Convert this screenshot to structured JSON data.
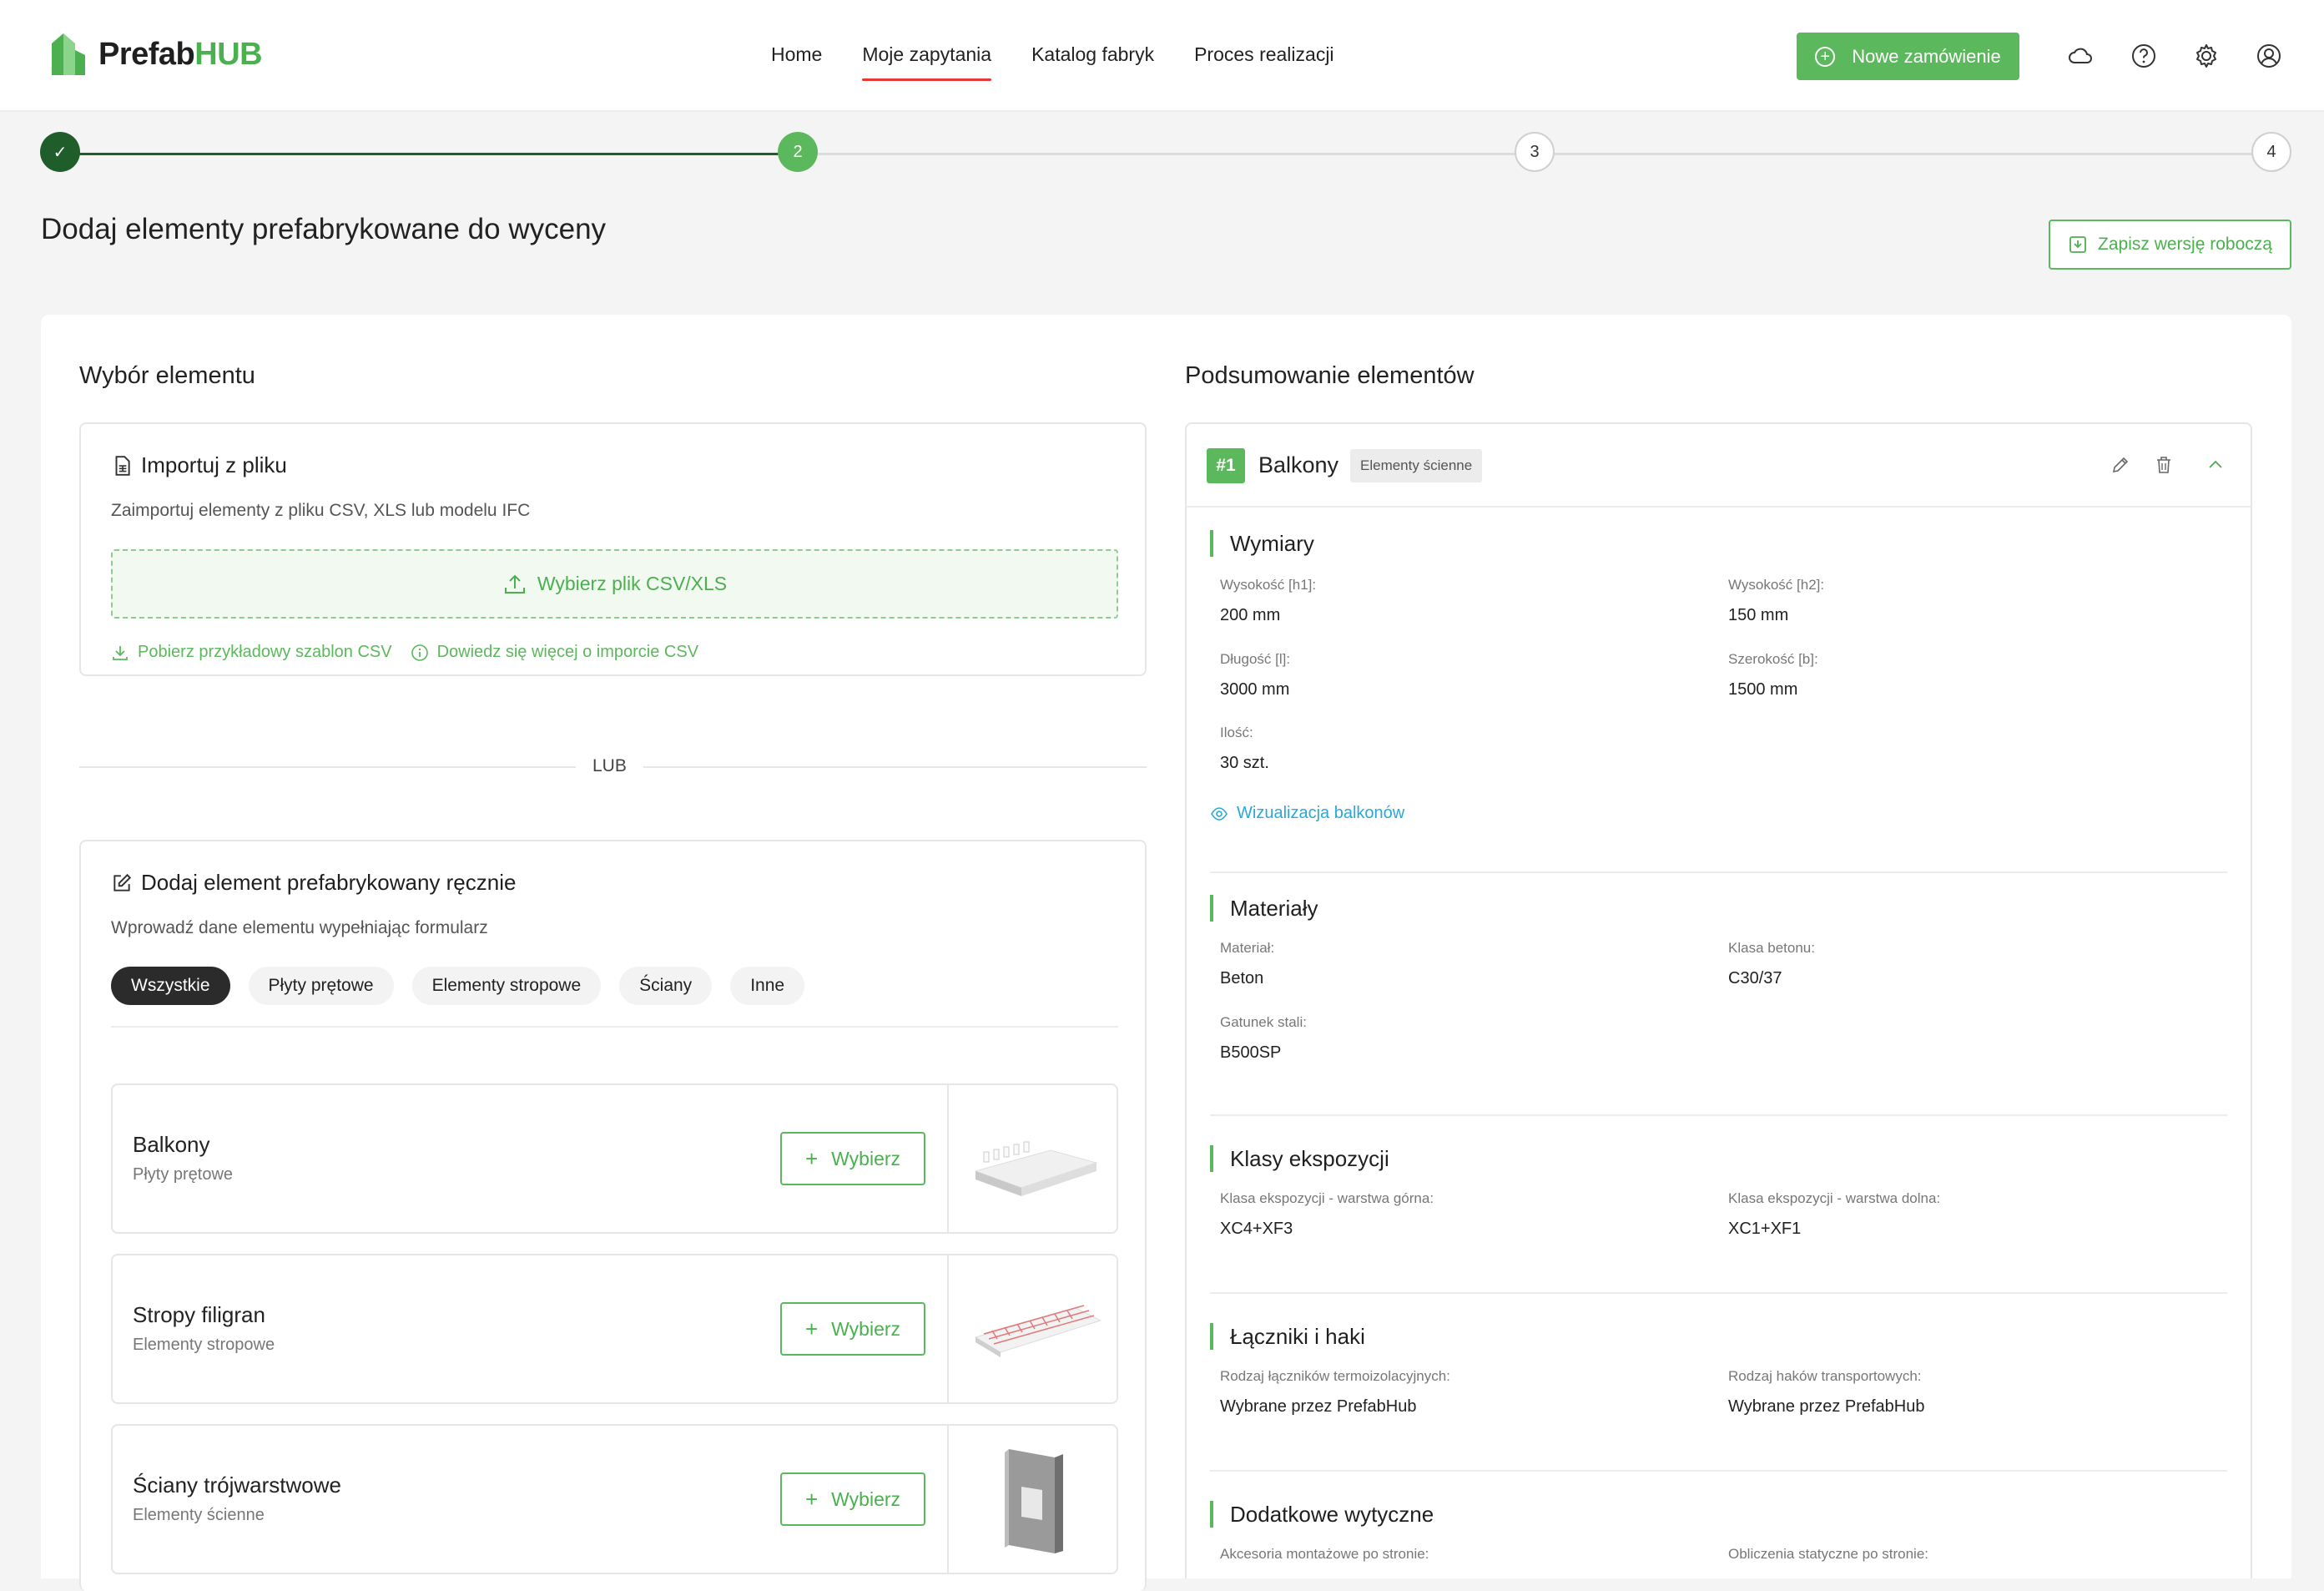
{
  "header": {
    "logo_text_1": "Prefab",
    "logo_text_2": "HUB",
    "nav": [
      "Home",
      "Moje zapytania",
      "Katalog fabryk",
      "Proces realizacji"
    ],
    "active_nav": "Moje zapytania",
    "new_order_label": "Nowe zamówienie",
    "icons": [
      "cloud-icon",
      "help-icon",
      "settings-icon",
      "user-icon"
    ]
  },
  "stepper": {
    "steps": [
      "✓",
      "2",
      "3",
      "4"
    ],
    "current": 2
  },
  "page": {
    "title": "Dodaj elementy prefabrykowane do wyceny",
    "draft_label": "Zapisz wersję roboczą"
  },
  "left": {
    "section_title": "Wybór elementu",
    "import": {
      "title": "Importuj z pliku",
      "desc": "Zaimportuj elementy z pliku CSV, XLS lub modelu IFC",
      "upload_label": "Wybierz plik CSV/XLS",
      "link_template": "Pobierz przykładowy szablon CSV",
      "link_more": "Dowiedz się więcej o imporcie CSV"
    },
    "or_label": "LUB",
    "manual": {
      "title": "Dodaj element prefabrykowany ręcznie",
      "desc": "Wprowadź dane elementu wypełniając formularz",
      "chips": [
        "Wszystkie",
        "Płyty prętowe",
        "Elementy stropowe",
        "Ściany",
        "Inne"
      ],
      "active_chip": "Wszystkie",
      "select_label": "Wybierz",
      "elements": [
        {
          "name": "Balkony",
          "category": "Płyty prętowe"
        },
        {
          "name": "Stropy filigran",
          "category": "Elementy stropowe"
        },
        {
          "name": "Ściany trójwarstwowe",
          "category": "Elementy ścienne"
        }
      ]
    }
  },
  "right": {
    "section_title": "Podsumowanie elementów",
    "item": {
      "number": "#1",
      "name": "Balkony",
      "tag": "Elementy ścienne"
    },
    "dimensions": {
      "title": "Wymiary",
      "h1_label": "Wysokość [h1]:",
      "h1_value": "200 mm",
      "h2_label": "Wysokość [h2]:",
      "h2_value": "150 mm",
      "l_label": "Długość [l]:",
      "l_value": "3000 mm",
      "b_label": "Szerokość [b]:",
      "b_value": "1500 mm",
      "qty_label": "Ilość:",
      "qty_value": "30 szt.",
      "viz_link": "Wizualizacja balkonów"
    },
    "materials": {
      "title": "Materiały",
      "material_label": "Materiał:",
      "material_value": "Beton",
      "concrete_label": "Klasa betonu:",
      "concrete_value": "C30/37",
      "steel_label": "Gatunek stali:",
      "steel_value": "B500SP"
    },
    "exposure": {
      "title": "Klasy ekspozycji",
      "top_label": "Klasa ekspozycji - warstwa górna:",
      "top_value": "XC4+XF3",
      "bottom_label": "Klasa ekspozycji - warstwa dolna:",
      "bottom_value": "XC1+XF1"
    },
    "connectors": {
      "title": "Łączniki i haki",
      "thermo_label": "Rodzaj łączników termoizolacyjnych:",
      "thermo_value": "Wybrane przez PrefabHub",
      "hooks_label": "Rodzaj haków transportowych:",
      "hooks_value": "Wybrane przez PrefabHub"
    },
    "additional": {
      "title": "Dodatkowe wytyczne",
      "acc_label": "Akcesoria montażowe po stronie:",
      "calc_label": "Obliczenia statyczne po stronie:"
    }
  },
  "colors": {
    "accent": "#5cb85c",
    "dark_green": "#1f5e2a",
    "nav_underline": "#e53935",
    "link_blue": "#29a8d9"
  }
}
